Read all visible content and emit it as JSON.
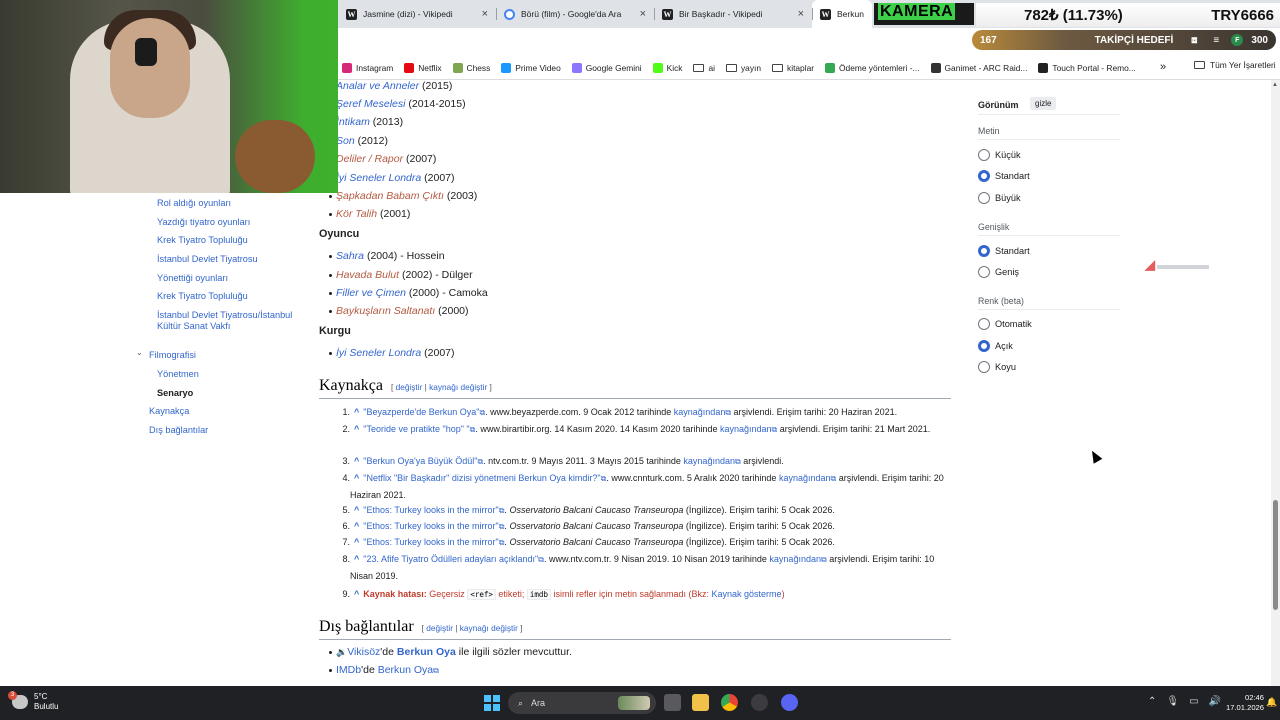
{
  "browser": {
    "tabs": [
      {
        "title": "Jasmine (dizi) - Vikipedi",
        "icon": "wikipedia-icon"
      },
      {
        "title": "Börü (film) - Google'da Ara",
        "icon": "google-icon"
      },
      {
        "title": "Bir Başkadır - Vikipedi",
        "icon": "wikipedia-icon"
      },
      {
        "title": "Berkun O",
        "icon": "wikipedia-icon"
      }
    ],
    "close_glyph": "×",
    "bookmarks": [
      {
        "label": "Instagram",
        "color": "#d62976"
      },
      {
        "label": "Netflix",
        "color": "#e50914"
      },
      {
        "label": "Chess",
        "color": "#7fa650"
      },
      {
        "label": "Prime Video",
        "color": "#1a98ff"
      },
      {
        "label": "Google Gemini",
        "color": "#8e75ff"
      },
      {
        "label": "Kick",
        "color": "#53fc18"
      },
      {
        "label": "ai",
        "color": "folder"
      },
      {
        "label": "yayın",
        "color": "folder"
      },
      {
        "label": "kitaplar",
        "color": "folder"
      },
      {
        "label": "Ödeme yöntemleri -...",
        "color": "#34a853"
      },
      {
        "label": "Ganimet - ARC Raid...",
        "color": "#333333"
      },
      {
        "label": "Touch Portal - Remo...",
        "color": "#222222"
      }
    ],
    "bookmarks_more": "»",
    "all_bookmarks": "Tüm Yer İşaretleri"
  },
  "overlay": {
    "kamera": "KAMERA",
    "ticker_value": "782₺ (11.73%)",
    "ticker_pair": "TRY6666",
    "goal_count": "167",
    "goal_label": "TAKİPÇİ HEDEFİ",
    "goal_target": "300",
    "goal_coin": "F"
  },
  "toc": {
    "items": [
      {
        "label": "Rol aldığı oyunları"
      },
      {
        "label": "Yazdığı tiyatro oyunları"
      },
      {
        "label": "Krek Tiyatro Topluluğu"
      },
      {
        "label": "İstanbul Devlet Tiyatrosu"
      },
      {
        "label": "Yönettiği oyunları"
      },
      {
        "label": "Krek Tiyatro Topluluğu"
      },
      {
        "label": "İstanbul Devlet Tiyatrosu/İstanbul Kültür Sanat Vakfı"
      },
      {
        "label": "Filmografisi"
      },
      {
        "label": "Yönetmen"
      },
      {
        "label": "Senaryo"
      },
      {
        "label": "Kaynakça"
      },
      {
        "label": "Dış bağlantılar"
      }
    ],
    "caret": "⌄"
  },
  "article": {
    "senaryo_list": [
      {
        "title": "Analar ve Anneler",
        "year": " (2015)",
        "red": false
      },
      {
        "title": "Şeref Meselesi",
        "year": " (2014-2015)",
        "red": false
      },
      {
        "title": "İntikam",
        "year": " (2013)",
        "red": false
      },
      {
        "title": "Son",
        "year": " (2012)",
        "red": false
      },
      {
        "title": "Deliler / Rapor",
        "year": " (2007)",
        "red": true
      },
      {
        "title": "İyi Seneler Londra",
        "year": " (2007)",
        "red": false
      },
      {
        "title": "Şapkadan Babam Çıktı",
        "year": " (2003)",
        "red": true
      },
      {
        "title": "Kör Talih",
        "year": " (2001)",
        "red": true
      }
    ],
    "oyuncu_heading": "Oyuncu",
    "oyuncu_list": [
      {
        "title": "Sahra",
        "year": " (2004) - Hossein",
        "red": false
      },
      {
        "title": "Havada Bulut",
        "year": " (2002) - Dülger",
        "red": true
      },
      {
        "title": "Filler ve Çimen",
        "year": " (2000) - Camoka",
        "red": false
      },
      {
        "title": "Baykuşların Saltanatı",
        "year": " (2000)",
        "red": true
      }
    ],
    "kurgu_heading": "Kurgu",
    "kurgu_list": [
      {
        "title": "İyi Seneler Londra",
        "year": " (2007)",
        "red": false
      }
    ],
    "kaynakca_heading": "Kaynakça",
    "edit_label": "değiştir",
    "edit_sep": " | ",
    "edit_source_label": "kaynağı değiştir",
    "bracket_open": "[ ",
    "bracket_close": " ]",
    "references": [
      {
        "n": "1.",
        "html": "<span class='rl'>\"Beyazperde'de Berkun Oya\"</span><span class='ext'>⧉</span>. www.beyazperde.com. 9 Ocak 2012 tarihinde <span class='rl'>kaynağından</span><span class='ext'>⧉</span> arşivlendi. Erişim tarihi: 20 Haziran 2021."
      },
      {
        "n": "2.",
        "html": "<span class='rl'>\"Teoride ve pratikte \"hop\" \"</span><span class='ext'>⧉</span>. www.birartibir.org. 14 Kasım 2020. 14 Kasım 2020 tarihinde <span class='rl'>kaynağından</span><span class='ext'>⧉</span> arşivlendi. Erişim tarihi: 21 Mart 2021."
      },
      {
        "n": "3.",
        "html": "<span class='rl'>\"Berkun Oya'ya Büyük Ödül\"</span><span class='ext'>⧉</span>. ntv.com.tr. 9 Mayıs 2011. 3 Mayıs 2015 tarihinde <span class='rl'>kaynağından</span><span class='ext'>⧉</span> arşivlendi."
      },
      {
        "n": "4.",
        "html": "<span class='rl'>\"Netflix \"Bir Başkadır\" dizisi yönetmeni Berkun Oya kimdir?\"</span><span class='ext'>⧉</span>. www.cnnturk.com. 5 Aralık 2020 tarihinde <span class='rl'>kaynağından</span><span class='ext'>⧉</span> arşivlendi. Erişim tarihi: 20 Haziran 2021."
      },
      {
        "n": "5.",
        "html": "<span class='rl'>\"Ethos: Turkey looks in the mirror\"</span><span class='ext'>⧉</span>. <span class='it'>Osservatorio Balcani Caucaso Transeuropa</span> (İngilizce). Erişim tarihi: 5 Ocak 2026."
      },
      {
        "n": "6.",
        "html": "<span class='rl'>\"Ethos: Turkey looks in the mirror\"</span><span class='ext'>⧉</span>. <span class='it'>Osservatorio Balcani Caucaso Transeuropa</span> (İngilizce). Erişim tarihi: 5 Ocak 2026."
      },
      {
        "n": "7.",
        "html": "<span class='rl'>\"Ethos: Turkey looks in the mirror\"</span><span class='ext'>⧉</span>. <span class='it'>Osservatorio Balcani Caucaso Transeuropa</span> (İngilizce). Erişim tarihi: 5 Ocak 2026."
      },
      {
        "n": "8.",
        "html": "<span class='rl'>\"23. Afife Tiyatro Ödülleri adayları açıklandı\"</span><span class='ext'>⧉</span>. www.ntv.com.tr. 9 Nisan 2019. 10 Nisan 2019 tarihinde <span class='rl'>kaynağından</span><span class='ext'>⧉</span> arşivlendi. Erişim tarihi: 10 Nisan 2019."
      },
      {
        "n": "9.",
        "html": "<span class='err'><b>Kaynak hatası:</b> Geçersiz <code>&lt;ref&gt;</code> etiketi; <code>imdb</code> isimli refler için metin sağlanmadı (Bkz: <span class='rl'>Kaynak gösterme</span>)</span>"
      }
    ],
    "ref_caret": "^",
    "dis_heading": "Dış bağlantılar",
    "external": [
      {
        "pre": "",
        "link": "Vikisöz",
        "mid": "'de ",
        "bold": "Berkun Oya",
        "post": " ile ilgili sözler mevcuttur."
      },
      {
        "pre": "",
        "link": "IMDb",
        "mid": "'de ",
        "bold": "Berkun Oya",
        "post": ""
      }
    ]
  },
  "appearance": {
    "title": "Görünüm",
    "hide": "gizle",
    "metin_label": "Metin",
    "metin_options": [
      {
        "label": "Küçük",
        "checked": false
      },
      {
        "label": "Standart",
        "checked": true
      },
      {
        "label": "Büyük",
        "checked": false
      }
    ],
    "genislik_label": "Genişlik",
    "genislik_options": [
      {
        "label": "Standart",
        "checked": true
      },
      {
        "label": "Geniş",
        "checked": false
      }
    ],
    "renk_label": "Renk (beta)",
    "renk_options": [
      {
        "label": "Otomatik",
        "checked": false
      },
      {
        "label": "Açık",
        "checked": true
      },
      {
        "label": "Koyu",
        "checked": false
      }
    ]
  },
  "taskbar": {
    "temperature": "5°C",
    "weather": "Bulutlu",
    "search_label": "Ara",
    "time": "02:46",
    "date": "17.01.2026",
    "tray_icons": [
      "chevron-up-icon",
      "microphone-icon",
      "display-icon",
      "speaker-icon"
    ]
  }
}
